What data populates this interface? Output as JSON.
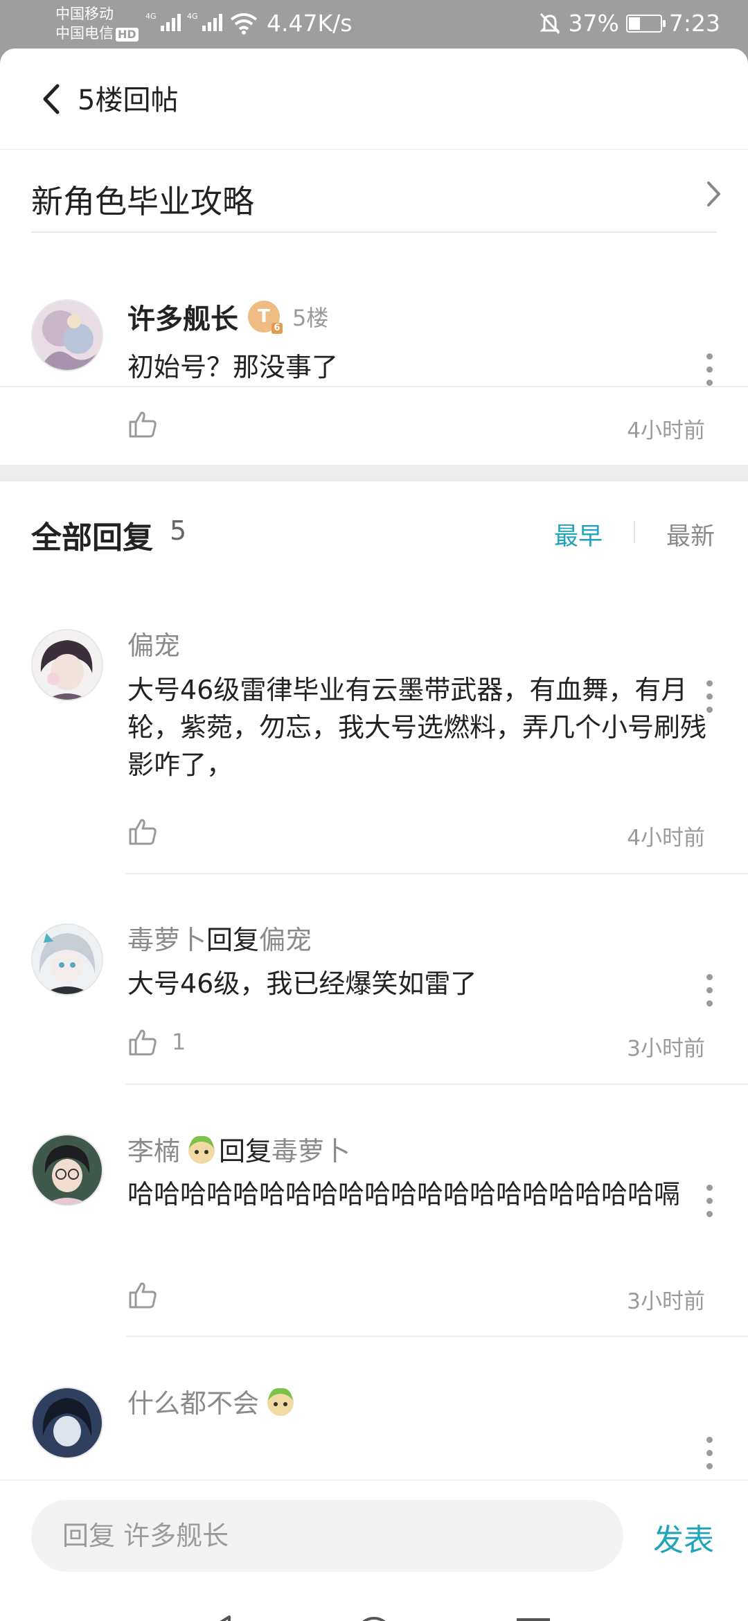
{
  "status_bar": {
    "carrier1": "中国移动",
    "carrier2": "中国电信",
    "hd": "HD",
    "net_tag1": "4G",
    "net_tag2": "4G",
    "speed": "4.47K/s",
    "battery": "37%",
    "battery_level": 0.37,
    "time": "7:23"
  },
  "header": {
    "title": "5楼回帖"
  },
  "topic": {
    "title": "新角色毕业攻略"
  },
  "post": {
    "author": "许多舰长",
    "badge": "T",
    "badge_level": "6",
    "floor": "5楼",
    "content": "初始号？那没事了",
    "time": "4小时前"
  },
  "replies_header": {
    "title": "全部回复",
    "count": "5",
    "sort_earliest": "最早",
    "sort_newest": "最新"
  },
  "replies": [
    {
      "author": "偏宠",
      "content": "大号46级雷律毕业有云墨带武器，有血舞，有月轮，紫菀，勿忘，我大号选燃料，弄几个小号刷残影咋了，",
      "likes": "",
      "time": "4小时前"
    },
    {
      "author": "毒萝卜",
      "reply_word": "回复",
      "reply_to": "偏宠",
      "content": "大号46级，我已经爆笑如雷了",
      "likes": "1",
      "time": "3小时前"
    },
    {
      "author": "李楠",
      "reply_word": "回复",
      "reply_to": "毒萝卜",
      "content": "哈哈哈哈哈哈哈哈哈哈哈哈哈哈哈哈哈哈哈哈嗝",
      "likes": "",
      "time": "3小时前"
    },
    {
      "author": "什么都不会"
    }
  ],
  "input": {
    "placeholder": "回复 许多舰长",
    "submit": "发表"
  },
  "colors": {
    "accent": "#1fa4b9",
    "status_bar": "#9e9e9e",
    "divider": "#ececec"
  }
}
